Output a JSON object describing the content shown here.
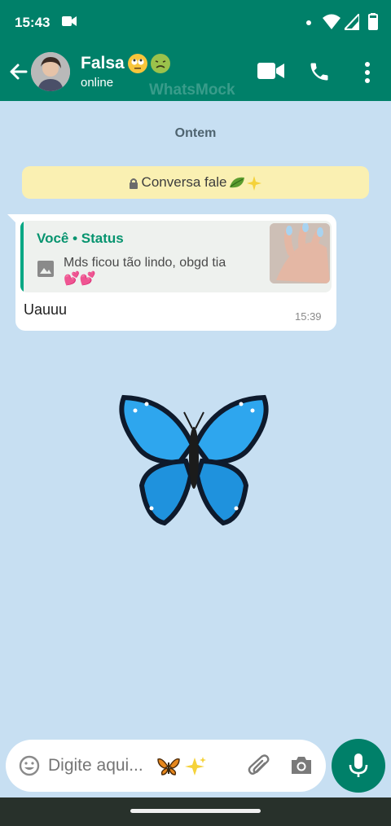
{
  "status_bar": {
    "time": "15:43",
    "icons": [
      "video-recording-icon",
      "notification-dot-icon",
      "wifi-icon",
      "cell-signal-icon",
      "battery-icon"
    ]
  },
  "app_bar": {
    "contact_name": "Falsa",
    "name_emojis": [
      "face-with-rolling-eyes-emoji",
      "nauseated-face-emoji"
    ],
    "presence": "online",
    "watermark": "WhatsMock",
    "icons": [
      "back-arrow-icon",
      "video-call-icon",
      "voice-call-icon",
      "more-options-icon"
    ]
  },
  "chat": {
    "date_label": "Ontem",
    "system_notice": "Conversa fale",
    "system_notice_emojis": [
      "leaf-emoji",
      "sparkles-emoji"
    ],
    "messages": [
      {
        "quote_author": "Você • Status",
        "quote_text": "Mds ficou tão lindo, obgd tia",
        "quote_emoji": "💕💕",
        "text": "Uauuu",
        "time": "15:39"
      }
    ],
    "sticker": "butterfly-emoji"
  },
  "composer": {
    "placeholder": "Digite aqui...",
    "placeholder_emojis": [
      "butterfly-emoji",
      "sparkles-emoji"
    ],
    "icons": [
      "emoji-icon",
      "attach-icon",
      "camera-icon",
      "mic-icon"
    ]
  },
  "colors": {
    "header_green": "#008069",
    "chat_background": "#c7dff2",
    "notice_yellow": "#faf0b2",
    "quote_green": "#07946f"
  }
}
